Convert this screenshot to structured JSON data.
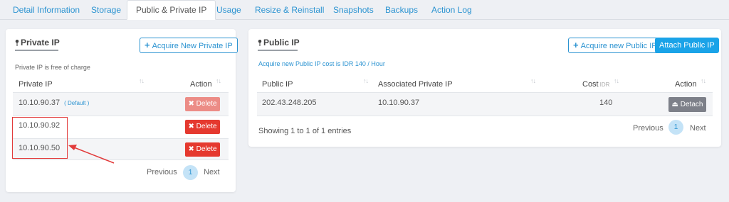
{
  "tabs": [
    "Detail Information",
    "Storage",
    "Public & Private IP",
    "Usage",
    "Resize & Reinstall",
    "Snapshots",
    "Backups",
    "Action Log"
  ],
  "colors": {
    "accent": "#2b93d1",
    "danger": "#e5392f",
    "danger_disabled": "#ec8c86",
    "primary_fill": "#1aa3e8",
    "detach": "#7d8089",
    "annotation": "#e23b3b"
  },
  "private_ip": {
    "title": "Private IP",
    "acquire_label": "Acquire New Private IP",
    "note": "Private IP is free of charge",
    "columns": [
      "Private IP",
      "Action"
    ],
    "rows": [
      {
        "ip": "10.10.90.37",
        "tag": "( Default )",
        "action": "Delete"
      },
      {
        "ip": "10.10.90.92",
        "tag": "",
        "action": "Delete"
      },
      {
        "ip": "10.10.90.50",
        "tag": "",
        "action": "Delete"
      }
    ],
    "pagination": {
      "prev": "Previous",
      "current": "1",
      "next": "Next"
    }
  },
  "public_ip": {
    "title": "Public IP",
    "acquire_label": "Acquire new Public IP",
    "attach_label": "Attach Public IP",
    "note": "Acquire new Public IP cost is IDR 140  / Hour",
    "columns": [
      "Public IP",
      "Associated Private IP",
      "Cost",
      "Action"
    ],
    "cost_unit": "IDR",
    "rows": [
      {
        "ip": "202.43.248.205",
        "associated": "10.10.90.37",
        "cost": "140",
        "action": "Detach"
      }
    ],
    "info": "Showing 1 to 1 of 1 entries",
    "pagination": {
      "prev": "Previous",
      "current": "1",
      "next": "Next"
    }
  },
  "icons": {
    "pin": "map-pin-icon",
    "plus": "plus-icon",
    "close": "x-icon",
    "eject": "eject-icon",
    "sort": "sort-arrows-icon"
  }
}
